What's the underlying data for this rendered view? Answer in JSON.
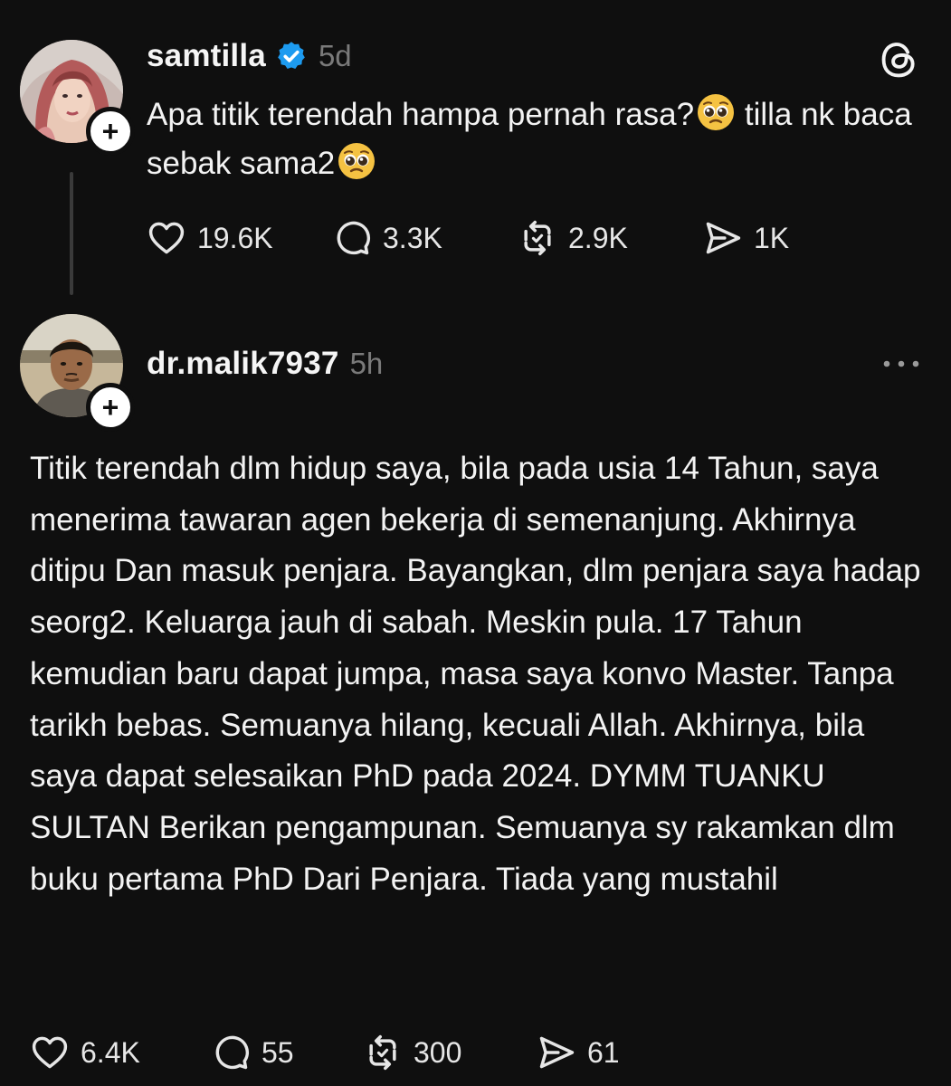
{
  "colors": {
    "background": "#0f0f0f",
    "text": "#f3f3f3",
    "muted": "#7a7a7a",
    "verified": "#1d9bf0",
    "thread_line": "#3a3a3a"
  },
  "parent_post": {
    "username": "samtilla",
    "verified": true,
    "timestamp": "5d",
    "text": "Apa titik terendah hampa pernah rasa?",
    "text_after_emoji": " tilla nk baca sebak sama2",
    "emoji": "pleading-face",
    "actions": {
      "likes": "19.6K",
      "replies": "3.3K",
      "reposts": "2.9K",
      "shares": "1K"
    },
    "icons": {
      "brand": "threads-logo-icon",
      "follow": "plus-icon"
    }
  },
  "reply_post": {
    "username": "dr.malik7937",
    "timestamp": "5h",
    "text": "Titik terendah dlm hidup saya, bila pada usia 14 Tahun, saya menerima tawaran agen bekerja di semenanjung. Akhirnya ditipu Dan masuk penjara. Bayangkan, dlm penjara saya hadap seorg2. Keluarga jauh di sabah. Meskin pula. 17 Tahun kemudian baru dapat jumpa, masa saya konvo Master. Tanpa tarikh bebas. Semuanya hilang, kecuali Allah. Akhirnya, bila saya dapat selesaikan PhD pada 2024. DYMM TUANKU SULTAN Berikan pengampunan. Semuanya sy rakamkan dlm buku pertama PhD Dari Penjara. Tiada yang mustahil",
    "actions": {
      "likes": "6.4K",
      "replies": "55",
      "reposts": "300",
      "shares": "61"
    },
    "icons": {
      "menu": "more-horizontal-icon",
      "follow": "plus-icon"
    }
  }
}
